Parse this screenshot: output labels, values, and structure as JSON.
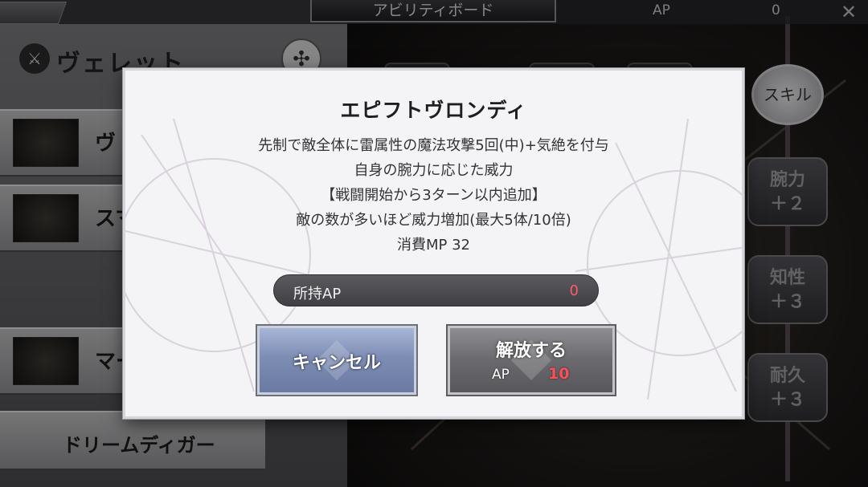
{
  "header": {
    "title": "アビリティボード",
    "ap_label": "AP",
    "ap_value": "0",
    "close_glyph": "✕"
  },
  "character": {
    "name": "ヴェレット"
  },
  "left_list": {
    "items": [
      "ヴ",
      "スマ",
      "マー"
    ],
    "bottom_item": "ドリームディガー"
  },
  "right_panel": {
    "skill_emblem": "スキル",
    "stats": [
      {
        "name": "腕力",
        "value": "＋２"
      },
      {
        "name": "知性",
        "value": "＋３"
      },
      {
        "name": "耐久",
        "value": "＋３"
      }
    ]
  },
  "dialog": {
    "title": "エピフトヴロンディ",
    "description": [
      "先制で敵全体に雷属性の魔法攻撃5回(中)+気絶を付与",
      "自身の腕力に応じた威力",
      "【戦闘開始から3ターン以内追加】",
      "敵の数が多いほど威力増加(最大5体/10倍)",
      "消費MP 32"
    ],
    "owned_ap_label": "所持AP",
    "owned_ap_value": "0",
    "cancel_label": "キャンセル",
    "unlock_label": "解放する",
    "unlock_ap_label": "AP",
    "unlock_ap_cost": "10"
  },
  "colors": {
    "accent_red": "#ff5a6a",
    "cancel_blue": "#7e8db4",
    "modal_bg": "#f4f3f6"
  }
}
